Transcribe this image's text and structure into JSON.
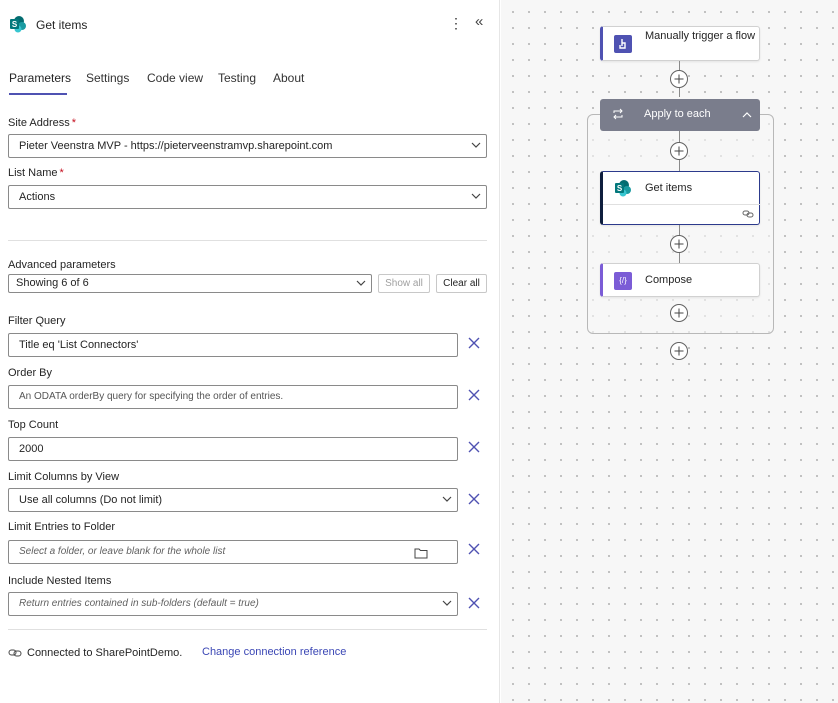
{
  "panel": {
    "title": "Get items",
    "more_icon": "more-vertical-icon",
    "collapse_icon": "double-chevron-left-icon",
    "tabs": [
      {
        "label": "Parameters",
        "active": true
      },
      {
        "label": "Settings"
      },
      {
        "label": "Code view"
      },
      {
        "label": "Testing"
      },
      {
        "label": "About"
      }
    ],
    "site_address": {
      "label": "Site Address",
      "value": "Pieter Veenstra MVP - https://pieterveenstramvp.sharepoint.com"
    },
    "list_name": {
      "label": "List Name",
      "value": "Actions"
    },
    "required_mark": "*",
    "advanced": {
      "label": "Advanced parameters",
      "value": "Showing 6 of 6",
      "show_all": "Show all",
      "clear_all": "Clear all"
    },
    "filter_query": {
      "label": "Filter Query",
      "value": "Title eq 'List Connectors'"
    },
    "order_by": {
      "label": "Order By",
      "placeholder": "An ODATA orderBy query for specifying the order of entries."
    },
    "top_count": {
      "label": "Top Count",
      "value": "2000"
    },
    "limit_columns": {
      "label": "Limit Columns by View",
      "value": "Use all columns (Do not limit)"
    },
    "limit_folder": {
      "label": "Limit Entries to Folder",
      "placeholder": "Select a folder, or leave blank for the whole list"
    },
    "nested_items": {
      "label": "Include Nested Items",
      "placeholder": "Return entries contained in sub-folders (default = true)"
    },
    "connection": {
      "text": "Connected to SharePointDemo.",
      "link": "Change connection reference"
    }
  },
  "canvas": {
    "trigger": {
      "title": "Manually trigger a flow",
      "icon": "manual-trigger-icon",
      "accent": "#4f52b2"
    },
    "apply_each": {
      "title": "Apply to each",
      "icon": "loop-icon",
      "color": "#7a7d8c"
    },
    "get_items": {
      "title": "Get items",
      "icon": "sharepoint-icon",
      "accent": "#0f1e3d"
    },
    "compose": {
      "title": "Compose",
      "icon": "compose-icon",
      "accent": "#7b5cd6"
    }
  },
  "colors": {
    "tab_underline": "#4f52b2",
    "link": "#3b47b5",
    "required": "#c50f1f"
  }
}
